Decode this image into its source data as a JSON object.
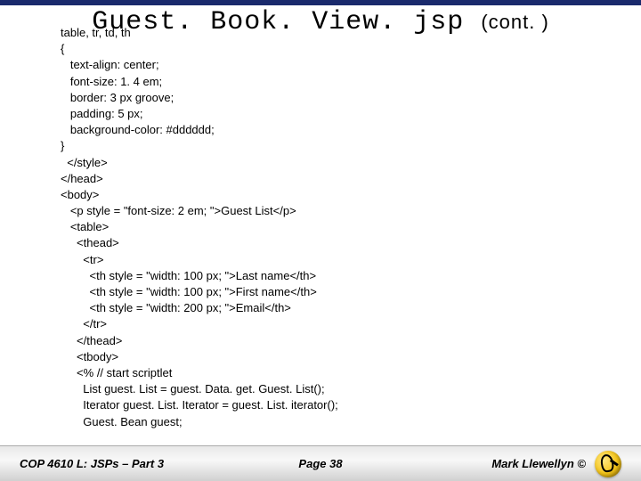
{
  "title_main": "Guest. Book. View. jsp",
  "title_cont": "(cont. )",
  "code_lines": [
    "table, tr, td, th",
    "{",
    "   text-align: center;",
    "   font-size: 1. 4 em;",
    "   border: 3 px groove;",
    "   padding: 5 px;",
    "   background-color: #dddddd;",
    "}",
    "</style>",
    "</head>",
    "<body>",
    "   <p style = \"font-size: 2 em; \">Guest List</p>",
    "   <table>",
    "     <thead>",
    "       <tr>",
    "         <th style = \"width: 100 px; \">Last name</th>",
    "         <th style = \"width: 100 px; \">First name</th>",
    "         <th style = \"width: 200 px; \">Email</th>",
    "       </tr>",
    "     </thead>",
    "     <tbody>",
    "     <% // start scriptlet",
    "       List guest. List = guest. Data. get. Guest. List();",
    "       Iterator guest. List. Iterator = guest. List. iterator();",
    "       Guest. Bean guest;"
  ],
  "footer": {
    "left": "COP 4610 L: JSPs – Part 3",
    "center": "Page 38",
    "right": "Mark Llewellyn ©"
  },
  "logo_name": "ucf-pegasus-logo"
}
